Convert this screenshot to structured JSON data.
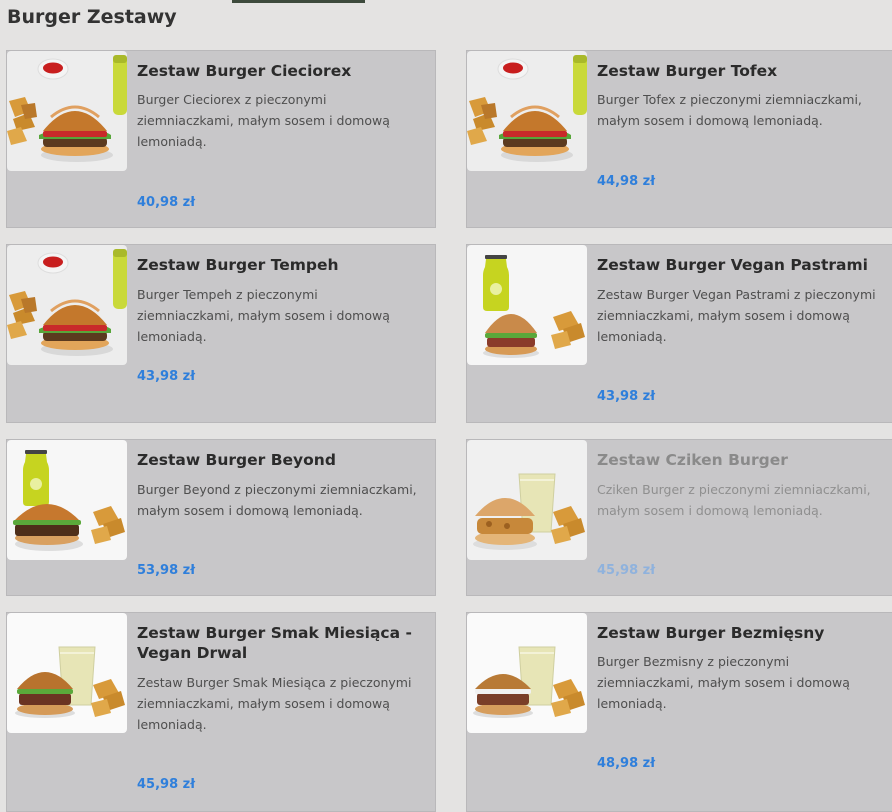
{
  "section": {
    "title": "Burger Zestawy"
  },
  "products": [
    {
      "title": "Zestaw Burger Cieciorex",
      "description": "Burger Cieciorex z pieczonymi ziemniaczkami, małym sosem i domową lemoniadą.",
      "price": "40,98 zł",
      "available": true
    },
    {
      "title": "Zestaw Burger Tofex",
      "description": "Burger Tofex z pieczonymi ziemniaczkami, małym sosem i domową lemoniadą.",
      "price": "44,98 zł",
      "available": true
    },
    {
      "title": "Zestaw Burger Tempeh",
      "description": "Burger Tempeh z pieczonymi ziemniaczkami, małym sosem i domową lemoniadą.",
      "price": "43,98 zł",
      "available": true
    },
    {
      "title": "Zestaw Burger Vegan Pastrami",
      "description": "Zestaw Burger Vegan Pastrami z pieczonymi ziemniaczkami, małym sosem i domową lemoniadą.",
      "price": "43,98 zł",
      "available": true
    },
    {
      "title": "Zestaw Burger Beyond",
      "description": "Burger Beyond z pieczonymi ziemniaczkami, małym sosem i domową lemoniadą.",
      "price": "53,98 zł",
      "available": true
    },
    {
      "title": "Zestaw Cziken Burger",
      "description": "Cziken Burger z pieczonymi ziemniaczkami, małym sosem i domową lemoniadą.",
      "price": "45,98 zł",
      "available": false
    },
    {
      "title": "Zestaw Burger Smak Miesiąca - Vegan Drwal",
      "description": "Zestaw Burger Smak Miesiąca z pieczonymi ziemniaczkami, małym sosem i domową lemoniadą.",
      "price": "45,98 zł",
      "available": true
    },
    {
      "title": "Zestaw Burger Bezmięsny",
      "description": "Burger Bezmisny z pieczonymi ziemniaczkami, małym sosem i domową lemoniadą.",
      "price": "48,98 zł",
      "available": true
    }
  ]
}
